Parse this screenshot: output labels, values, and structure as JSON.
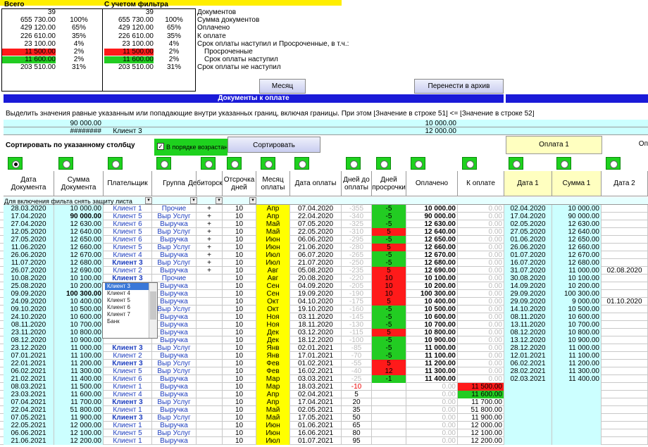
{
  "top": {
    "total_label": "Всего",
    "filter_label": "С учетом фильтра",
    "rows": [
      {
        "a": "39",
        "ap": "",
        "f": "39",
        "fp": "",
        "desc": "Документов",
        "hl": ""
      },
      {
        "a": "655 730.00",
        "ap": "100%",
        "f": "655 730.00",
        "fp": "100%",
        "desc": "Сумма документов",
        "hl": ""
      },
      {
        "a": "429 120.00",
        "ap": "65%",
        "f": "429 120.00",
        "fp": "65%",
        "desc": "Оплачено",
        "hl": ""
      },
      {
        "a": "226 610.00",
        "ap": "35%",
        "f": "226 610.00",
        "fp": "35%",
        "desc": "К оплате",
        "hl": ""
      },
      {
        "a": "23 100.00",
        "ap": "4%",
        "f": "23 100.00",
        "fp": "4%",
        "desc": "Срок оплаты наступил и Просроченные, в т.ч.:",
        "hl": ""
      },
      {
        "a": "11 500.00",
        "ap": "2%",
        "f": "11 500.00",
        "fp": "2%",
        "desc": "Просроченные",
        "hl": "red"
      },
      {
        "a": "11 600.00",
        "ap": "2%",
        "f": "11 600.00",
        "fp": "2%",
        "desc": "Срок оплаты наступил",
        "hl": "grn"
      },
      {
        "a": "203 510.00",
        "ap": "31%",
        "f": "203 510.00",
        "fp": "31%",
        "desc": "Срок оплаты не наступил",
        "hl": ""
      }
    ]
  },
  "buttons": {
    "month": "Месяц",
    "archive": "Перенести в архив",
    "sort": "Сортировать"
  },
  "banner": "Документы к оплате",
  "filter_note": "Выделить значения равные указанным или попадающие внутри указанных границ, включая границы. При этом [Значение в строке 51] <= [Значение в строке 52]",
  "filter_vals": {
    "sum1": "90 000.00",
    "sum2": "########",
    "client": "Клиент 3",
    "pay1": "10 000.00",
    "pay2": "12 000.00"
  },
  "sort_label": "Сортировать по указанному столбцу",
  "asc_label": "В порядке возрастания",
  "pay1_label": "Оплата 1",
  "pay2_label": "Оп",
  "headers": [
    "Дата Документа",
    "Сумма Документа",
    "Плательщик",
    "Группа",
    "Дебиторская",
    "Отсрочка дней",
    "Месяц оплаты",
    "Дата оплаты",
    "Дней до оплаты",
    "Дней просрочки",
    "Оплачено",
    "К оплате",
    "Дата 1",
    "Сумма 1",
    "Дата 2"
  ],
  "filter_hint": "Для включения фильта снять защиту листа",
  "dropdown": [
    "Клиент 3",
    "Клиент 4",
    "Клиент 5",
    "Клиент 6",
    "Клиент 7",
    "Банк"
  ],
  "rows": [
    [
      "28.03.2020",
      "10 000.00",
      "Клиент 1",
      "Прочие",
      "+",
      "10",
      "Апр",
      "07.04.2020",
      "-355",
      "-5",
      "10 000.00",
      "0.00",
      "02.04.2020",
      "10 000.00",
      ""
    ],
    [
      "17.04.2020",
      "90 000.00",
      "Клиент 5",
      "Выр Услуг",
      "+",
      "10",
      "Апр",
      "22.04.2020",
      "-340",
      "-5",
      "90 000.00",
      "0.00",
      "17.04.2020",
      "90 000.00",
      ""
    ],
    [
      "27.04.2020",
      "12 630.00",
      "Клиент 6",
      "Выручка",
      "+",
      "10",
      "Май",
      "07.05.2020",
      "-325",
      "-5",
      "12 630.00",
      "0.00",
      "02.05.2020",
      "12 630.00",
      ""
    ],
    [
      "12.05.2020",
      "12 640.00",
      "Клиент 5",
      "Выр Услуг",
      "+",
      "10",
      "Май",
      "22.05.2020",
      "-310",
      "5",
      "12 640.00",
      "0.00",
      "27.05.2020",
      "12 640.00",
      ""
    ],
    [
      "27.05.2020",
      "12 650.00",
      "Клиент 6",
      "Выручка",
      "+",
      "10",
      "Июн",
      "06.06.2020",
      "-295",
      "-5",
      "12 650.00",
      "0.00",
      "01.06.2020",
      "12 650.00",
      ""
    ],
    [
      "11.06.2020",
      "12 660.00",
      "Клиент 5",
      "Выр Услуг",
      "+",
      "10",
      "Июн",
      "21.06.2020",
      "-280",
      "5",
      "12 660.00",
      "0.00",
      "26.06.2020",
      "12 660.00",
      ""
    ],
    [
      "26.06.2020",
      "12 670.00",
      "Клиент 4",
      "Выручка",
      "+",
      "10",
      "Июл",
      "06.07.2020",
      "-265",
      "-5",
      "12 670.00",
      "0.00",
      "01.07.2020",
      "12 670.00",
      ""
    ],
    [
      "11.07.2020",
      "12 680.00",
      "Клиент 3",
      "Выр Услуг",
      "+",
      "10",
      "Июл",
      "21.07.2020",
      "-250",
      "-5",
      "12 680.00",
      "0.00",
      "16.07.2020",
      "12 680.00",
      ""
    ],
    [
      "26.07.2020",
      "12 690.00",
      "Клиент 2",
      "Выручка",
      "+",
      "10",
      "Авг",
      "05.08.2020",
      "-235",
      "5",
      "12 690.00",
      "0.00",
      "31.07.2020",
      "11 000.00",
      "02.08.2020"
    ],
    [
      "10.08.2020",
      "10 100.00",
      "Клиент 3",
      "Прочие",
      "",
      "10",
      "Авг",
      "20.08.2020",
      "-220",
      "10",
      "10 100.00",
      "0.00",
      "30.08.2020",
      "10 100.00",
      ""
    ],
    [
      "25.08.2020",
      "10 200.00",
      "",
      "Выручка",
      "",
      "10",
      "Сен",
      "04.09.2020",
      "-205",
      "10",
      "10 200.00",
      "0.00",
      "14.09.2020",
      "10 200.00",
      ""
    ],
    [
      "09.09.2020",
      "100 300.00",
      "",
      "Выручка",
      "",
      "10",
      "Сен",
      "19.09.2020",
      "-190",
      "10",
      "100 300.00",
      "0.00",
      "29.09.2020",
      "100 300.00",
      ""
    ],
    [
      "24.09.2020",
      "10 400.00",
      "",
      "Выручка",
      "",
      "10",
      "Окт",
      "04.10.2020",
      "-175",
      "5",
      "10 400.00",
      "0.00",
      "29.09.2020",
      "9 000.00",
      "01.10.2020"
    ],
    [
      "09.10.2020",
      "10 500.00",
      "",
      "Выр Услуг",
      "",
      "10",
      "Окт",
      "19.10.2020",
      "-160",
      "-5",
      "10 500.00",
      "0.00",
      "14.10.2020",
      "10 500.00",
      ""
    ],
    [
      "24.10.2020",
      "10 600.00",
      "",
      "Выручка",
      "",
      "10",
      "Ноя",
      "03.11.2020",
      "-145",
      "-5",
      "10 600.00",
      "0.00",
      "08.11.2020",
      "10 600.00",
      ""
    ],
    [
      "08.11.2020",
      "10 700.00",
      "",
      "Выручка",
      "",
      "10",
      "Ноя",
      "18.11.2020",
      "-130",
      "-5",
      "10 700.00",
      "0.00",
      "13.11.2020",
      "10 700.00",
      ""
    ],
    [
      "23.11.2020",
      "10 800.00",
      "",
      "Выручка",
      "",
      "10",
      "Дек",
      "03.12.2020",
      "-115",
      "5",
      "10 800.00",
      "0.00",
      "08.12.2020",
      "10 800.00",
      ""
    ],
    [
      "08.12.2020",
      "10 900.00",
      "",
      "Выручка",
      "",
      "10",
      "Дек",
      "18.12.2020",
      "-100",
      "-5",
      "10 900.00",
      "0.00",
      "13.12.2020",
      "10 900.00",
      ""
    ],
    [
      "23.12.2020",
      "11 000.00",
      "Клиент 3",
      "Выр Услуг",
      "",
      "10",
      "Янв",
      "02.01.2021",
      "-85",
      "-5",
      "11 000.00",
      "0.00",
      "28.12.2020",
      "11 000.00",
      ""
    ],
    [
      "07.01.2021",
      "11 100.00",
      "Клиент 2",
      "Выручка",
      "",
      "10",
      "Янв",
      "17.01.2021",
      "-70",
      "-5",
      "11 100.00",
      "0.00",
      "12.01.2021",
      "11 100.00",
      ""
    ],
    [
      "22.01.2021",
      "11 200.00",
      "Клиент 3",
      "Выр Услуг",
      "",
      "10",
      "Фев",
      "01.02.2021",
      "-55",
      "5",
      "11 200.00",
      "0.00",
      "06.02.2021",
      "11 200.00",
      ""
    ],
    [
      "06.02.2021",
      "11 300.00",
      "Клиент 5",
      "Выр Услуг",
      "",
      "10",
      "Фев",
      "16.02.2021",
      "-40",
      "12",
      "11 300.00",
      "0.00",
      "28.02.2021",
      "11 300.00",
      ""
    ],
    [
      "21.02.2021",
      "11 400.00",
      "Клиент 6",
      "Выручка",
      "",
      "10",
      "Мар",
      "03.03.2021",
      "-25",
      "-1",
      "11 400.00",
      "0.00",
      "02.03.2021",
      "11 400.00",
      ""
    ],
    [
      "08.03.2021",
      "11 500.00",
      "Клиент 1",
      "Выручка",
      "",
      "10",
      "Мар",
      "18.03.2021",
      "-10",
      "",
      "0.00",
      "11 500.00",
      "",
      "",
      ""
    ],
    [
      "23.03.2021",
      "11 600.00",
      "Клиент 4",
      "Выручка",
      "",
      "10",
      "Апр",
      "02.04.2021",
      "5",
      "",
      "0.00",
      "11 600.00",
      "",
      "",
      ""
    ],
    [
      "07.04.2021",
      "11 700.00",
      "Клиент 3",
      "Выр Услуг",
      "",
      "10",
      "Апр",
      "17.04.2021",
      "20",
      "",
      "0.00",
      "11 700.00",
      "",
      "",
      ""
    ],
    [
      "22.04.2021",
      "51 800.00",
      "Клиент 1",
      "Выручка",
      "",
      "10",
      "Май",
      "02.05.2021",
      "35",
      "",
      "0.00",
      "51 800.00",
      "",
      "",
      ""
    ],
    [
      "07.05.2021",
      "11 900.00",
      "Клиент 3",
      "Выр Услуг",
      "",
      "10",
      "Май",
      "17.05.2021",
      "50",
      "",
      "0.00",
      "11 900.00",
      "",
      "",
      ""
    ],
    [
      "22.05.2021",
      "12 000.00",
      "Клиент 1",
      "Выручка",
      "",
      "10",
      "Июн",
      "01.06.2021",
      "65",
      "",
      "0.00",
      "12 000.00",
      "",
      "",
      ""
    ],
    [
      "06.06.2021",
      "12 100.00",
      "Клиент 5",
      "Выр Услуг",
      "",
      "10",
      "Июн",
      "16.06.2021",
      "80",
      "",
      "0.00",
      "12 100.00",
      "",
      "",
      ""
    ],
    [
      "21.06.2021",
      "12 200.00",
      "Клиент 1",
      "Выручка",
      "",
      "10",
      "Июл",
      "01.07.2021",
      "95",
      "",
      "0.00",
      "12 200.00",
      "",
      "",
      ""
    ]
  ]
}
